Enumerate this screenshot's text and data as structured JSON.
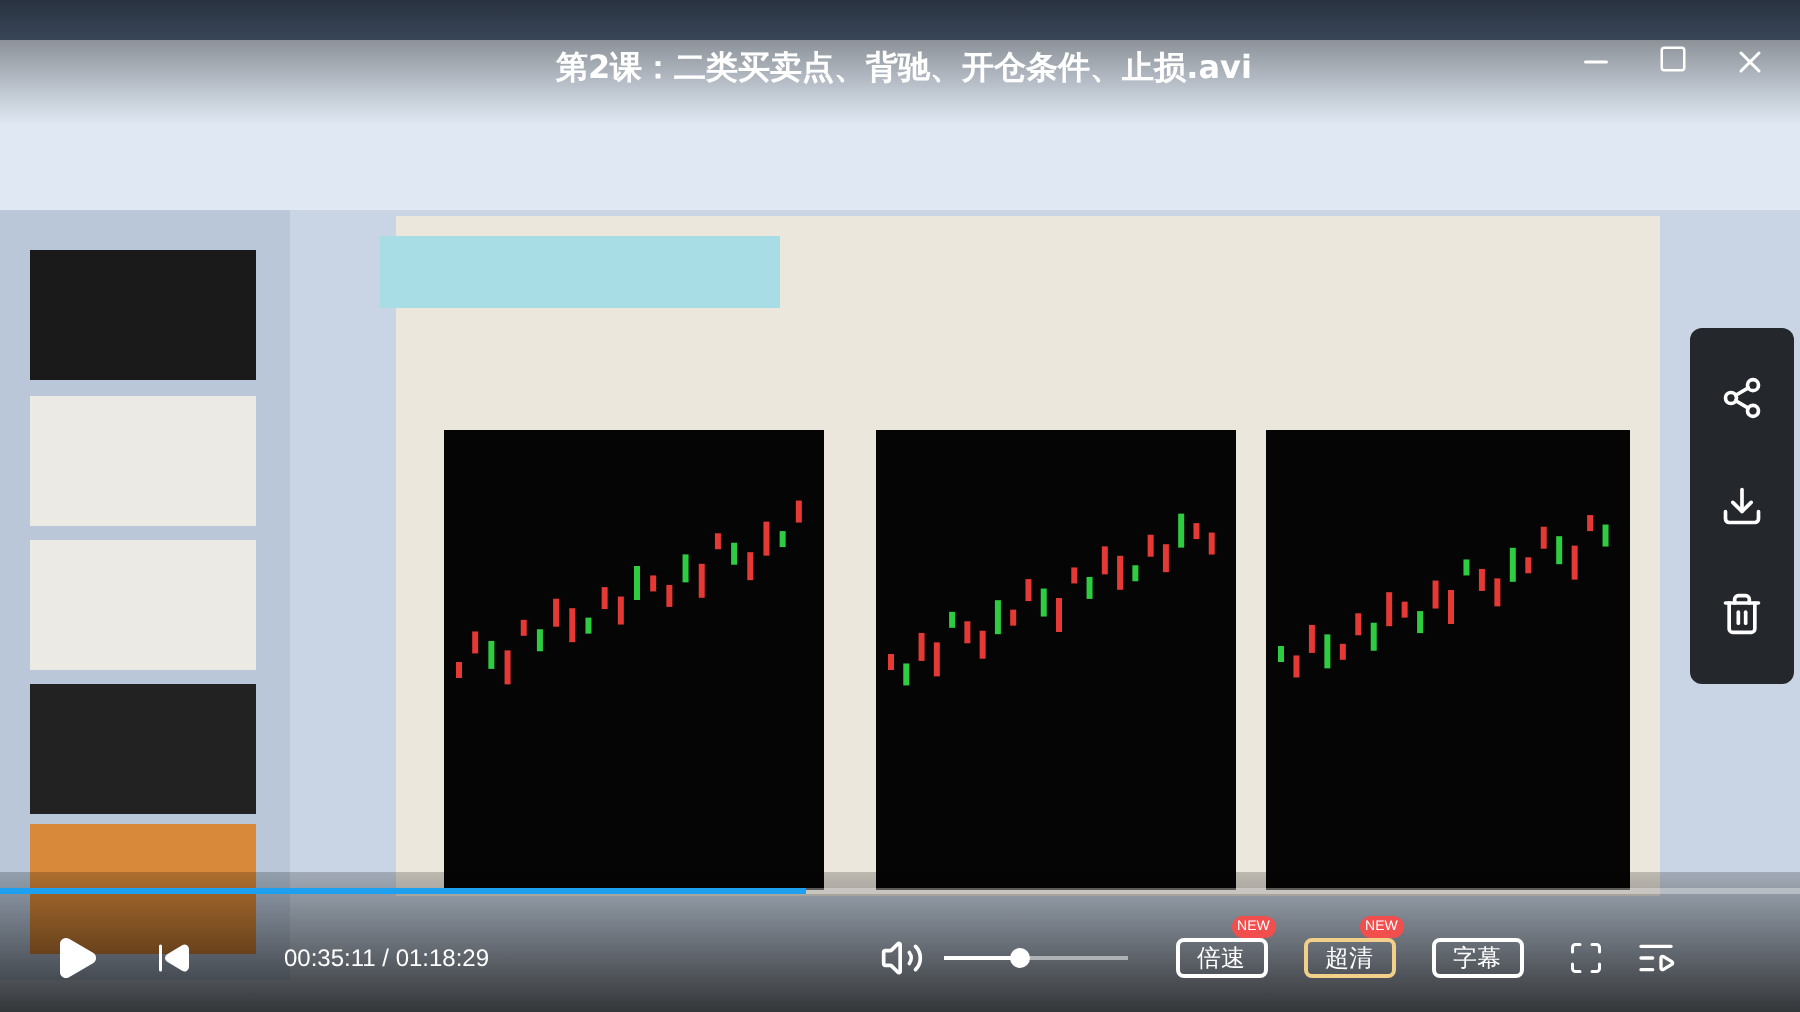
{
  "title": "第2课：二类买卖点、背驰、开仓条件、止损.avi",
  "progress": {
    "level": 0.448
  },
  "time": "00:35:11 / 01:18:29",
  "volume": {
    "level": 0.42
  },
  "buttons": [
    {
      "label": "倍速",
      "badge": "NEW",
      "selected": false
    },
    {
      "label": "超清",
      "badge": "NEW",
      "selected": true
    },
    {
      "label": "字幕",
      "selected": false
    }
  ]
}
